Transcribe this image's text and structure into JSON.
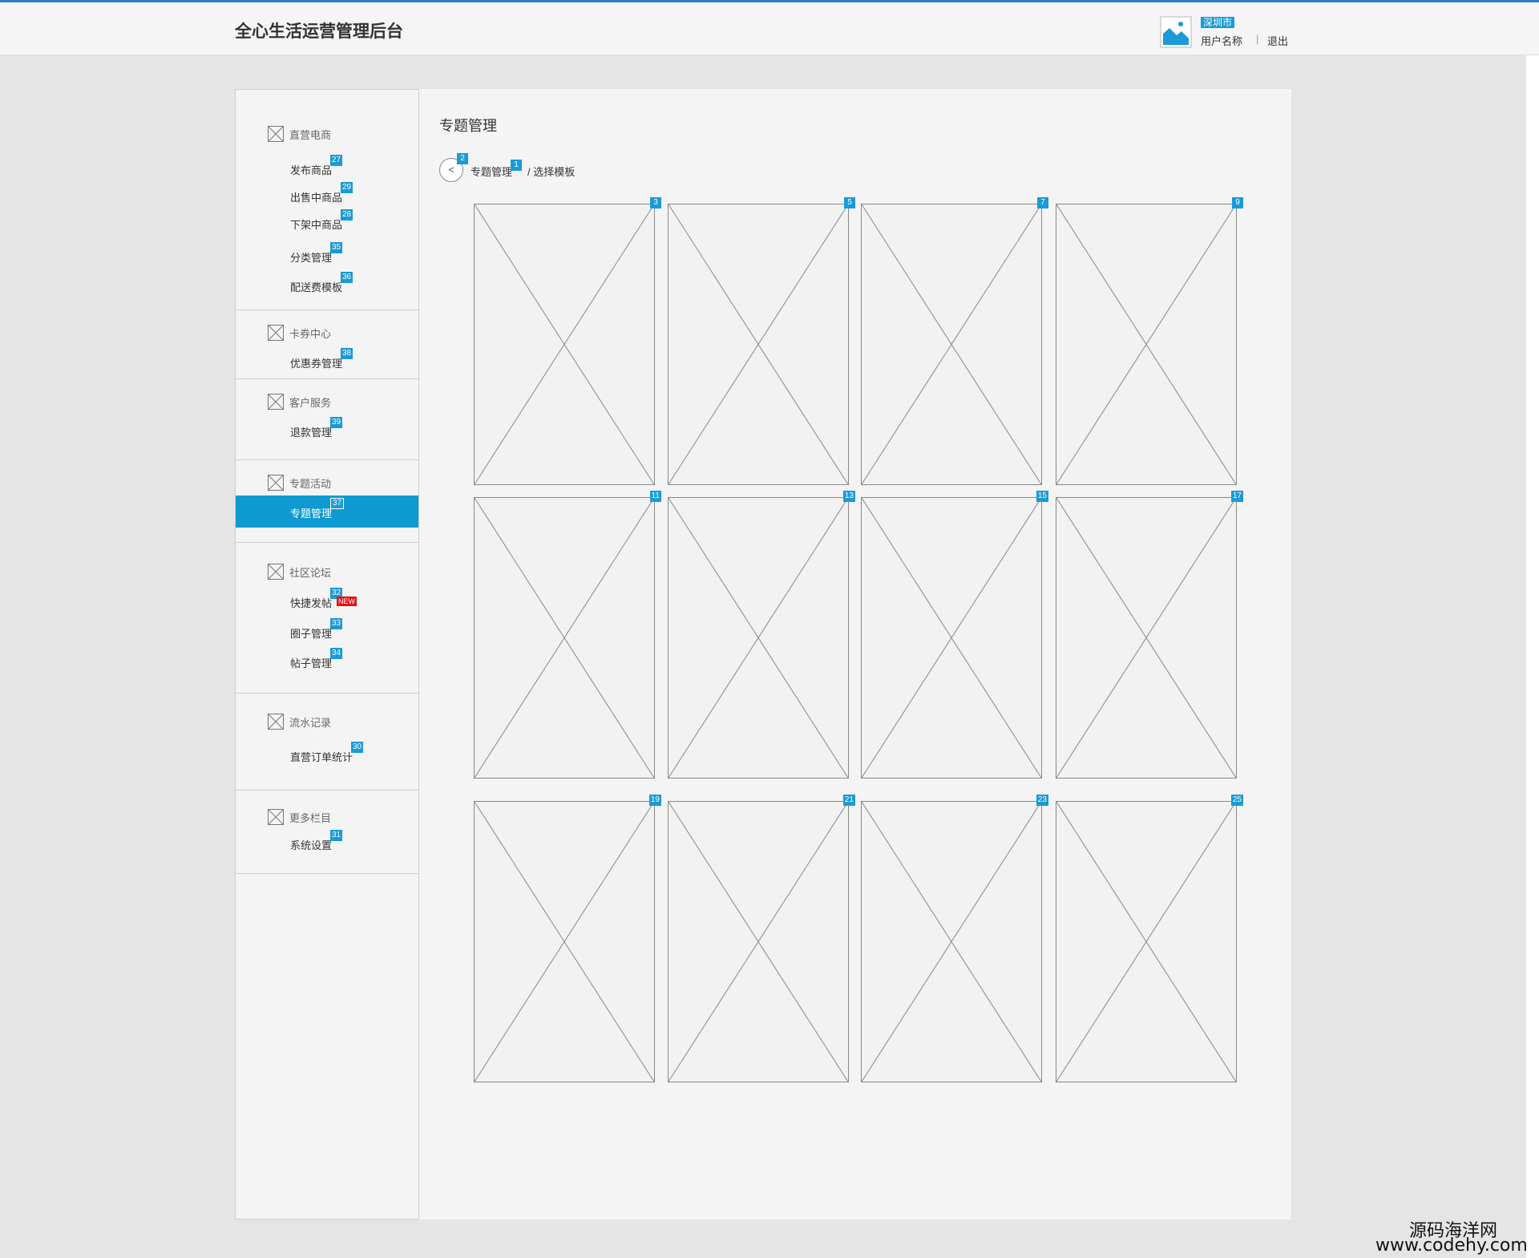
{
  "app": {
    "title": "全心生活运营管理后台"
  },
  "header": {
    "city": "深圳市",
    "user_name": "用户名称",
    "separator": "|",
    "logout": "退出",
    "avatar_icon": "image-placeholder-icon",
    "accent": "#1a9ad6"
  },
  "sidebar": {
    "section_icon": "placeholder-x-icon",
    "sections": [
      {
        "title": "直营电商",
        "items": [
          {
            "label": "发布商品",
            "badge": "27"
          },
          {
            "label": "出售中商品",
            "badge": "29"
          },
          {
            "label": "下架中商品",
            "badge": "28"
          },
          {
            "label": "分类管理",
            "badge": "35"
          },
          {
            "label": "配送费模板",
            "badge": "36"
          }
        ]
      },
      {
        "title": "卡券中心",
        "items": [
          {
            "label": "优惠券管理",
            "badge": "38"
          }
        ]
      },
      {
        "title": "客户服务",
        "items": [
          {
            "label": "退款管理",
            "badge": "39"
          }
        ]
      },
      {
        "title": "专题活动",
        "items": [
          {
            "label": "专题管理",
            "badge": "37",
            "active": true
          }
        ]
      },
      {
        "title": "社区论坛",
        "items": [
          {
            "label": "快捷发帖",
            "badge": "32",
            "tag": "NEW"
          },
          {
            "label": "圈子管理",
            "badge": "33"
          },
          {
            "label": "帖子管理",
            "badge": "34"
          }
        ]
      },
      {
        "title": "流水记录",
        "items": [
          {
            "label": "直营订单统计",
            "badge": "30"
          }
        ]
      },
      {
        "title": "更多栏目",
        "items": [
          {
            "label": "系统设置",
            "badge": "31"
          }
        ]
      }
    ]
  },
  "main": {
    "page_title": "专题管理",
    "back_label": "<",
    "back_badge": "2",
    "breadcrumb": {
      "first": "专题管理",
      "first_badge": "1",
      "second": "/ 选择模板"
    },
    "template_tiles": [
      {
        "badge": "3"
      },
      {
        "badge": "5"
      },
      {
        "badge": "7"
      },
      {
        "badge": "9"
      },
      {
        "badge": "11"
      },
      {
        "badge": "13"
      },
      {
        "badge": "15"
      },
      {
        "badge": "17"
      },
      {
        "badge": "19"
      },
      {
        "badge": "21"
      },
      {
        "badge": "23"
      },
      {
        "badge": "25"
      }
    ]
  },
  "watermark": {
    "line1": "源码海洋网",
    "line2": "www.codehy.com"
  }
}
